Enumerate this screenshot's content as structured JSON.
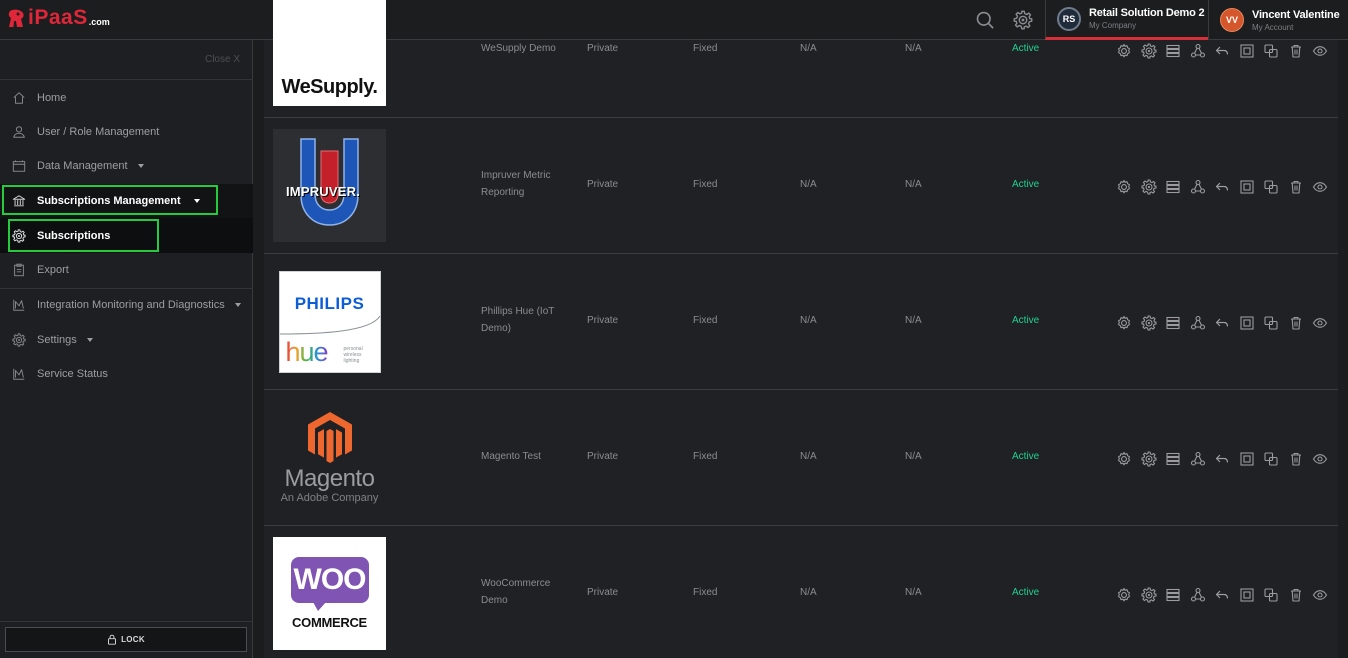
{
  "header": {
    "logo_text": "iPaaS",
    "logo_suffix": ".com",
    "company": {
      "initials": "RS",
      "name": "Retail Solution Demo 2",
      "sub": "My Company"
    },
    "user": {
      "initials": "VV",
      "name": "Vincent Valentine",
      "sub": "My Account"
    },
    "icons": [
      "search-icon",
      "gear-icon"
    ]
  },
  "sidebar": {
    "close_label": "Close X",
    "items": [
      {
        "label": "Home",
        "icon": "home-icon"
      },
      {
        "label": "User / Role Management",
        "icon": "user-icon"
      },
      {
        "label": "Data Management",
        "icon": "database-icon"
      },
      {
        "label": "Subscriptions Management",
        "icon": "bank-icon"
      },
      {
        "label": "Subscriptions",
        "icon": "gear-icon"
      },
      {
        "label": "Export",
        "icon": "clipboard-icon"
      },
      {
        "label": "Integration Monitoring and Diagnostics",
        "icon": "chart-icon"
      },
      {
        "label": "Settings",
        "icon": "gear-icon"
      },
      {
        "label": "Service Status",
        "icon": "chart-icon"
      }
    ],
    "lock_label": "LOCK"
  },
  "subscriptions": [
    {
      "name": "WeSupply Demo",
      "logo_text": "WeSupply.",
      "visibility": "Private",
      "plan": "Fixed",
      "col3": "N/A",
      "col4": "N/A",
      "status": "Active"
    },
    {
      "name": "Impruver Metric Reporting",
      "logo_text": "IMPRUVER.",
      "visibility": "Private",
      "plan": "Fixed",
      "col3": "N/A",
      "col4": "N/A",
      "status": "Active"
    },
    {
      "name": "Phillips Hue (IoT Demo)",
      "logo_text": "PHILIPS",
      "logo_text2": "hue",
      "logo_text3": "personal wireless lighting",
      "visibility": "Private",
      "plan": "Fixed",
      "col3": "N/A",
      "col4": "N/A",
      "status": "Active"
    },
    {
      "name": "Magento Test",
      "logo_text": "Magento",
      "logo_text2": "An Adobe Company",
      "visibility": "Private",
      "plan": "Fixed",
      "col3": "N/A",
      "col4": "N/A",
      "status": "Active"
    },
    {
      "name": "WooCommerce Demo",
      "logo_text": "WOO",
      "logo_text2": "COMMERCE",
      "visibility": "Private",
      "plan": "Fixed",
      "col3": "N/A",
      "col4": "N/A",
      "status": "Active"
    }
  ],
  "row_actions": [
    "settings-icon",
    "advanced-settings-icon",
    "list-icon",
    "network-icon",
    "undo-icon",
    "copy-frame-icon",
    "duplicate-icon",
    "trash-icon",
    "eye-icon"
  ],
  "colors": {
    "accent_red": "#d5303a",
    "status_green": "#1ed090",
    "highlight_green": "#27c93f"
  }
}
